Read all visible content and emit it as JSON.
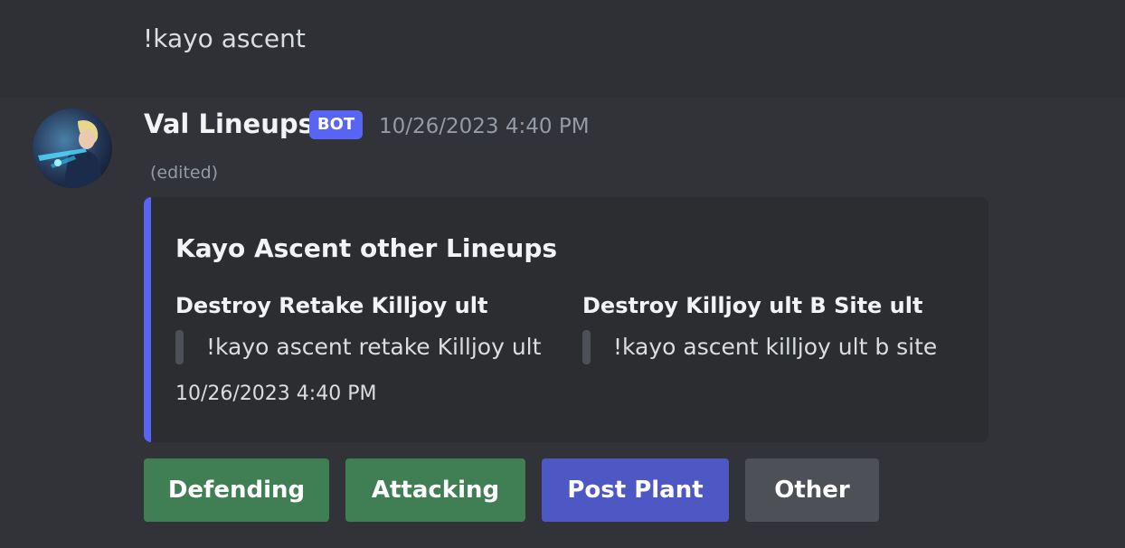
{
  "previous_message": {
    "cut_text": "~~~~ ~~~~",
    "text": "!kayo ascent"
  },
  "message": {
    "author": "Val Lineups",
    "badge": "BOT",
    "timestamp": "10/26/2023 4:40 PM",
    "edited_label": "(edited)"
  },
  "embed": {
    "accent_color": "#5865f2",
    "title": "Kayo Ascent other Lineups",
    "fields": [
      {
        "name": "Destroy Retake Killjoy ult",
        "value": "!kayo ascent retake Killjoy ult"
      },
      {
        "name": "Destroy Killjoy ult B Site ult",
        "value": "!kayo ascent killjoy ult b site"
      }
    ],
    "footer_timestamp": "10/26/2023 4:40 PM"
  },
  "buttons": [
    {
      "label": "Defending",
      "color": "#3f7f53"
    },
    {
      "label": "Attacking",
      "color": "#3f7f53"
    },
    {
      "label": "Post Plant",
      "color": "#4e58c4"
    },
    {
      "label": "Other",
      "color": "#4e5058"
    }
  ]
}
